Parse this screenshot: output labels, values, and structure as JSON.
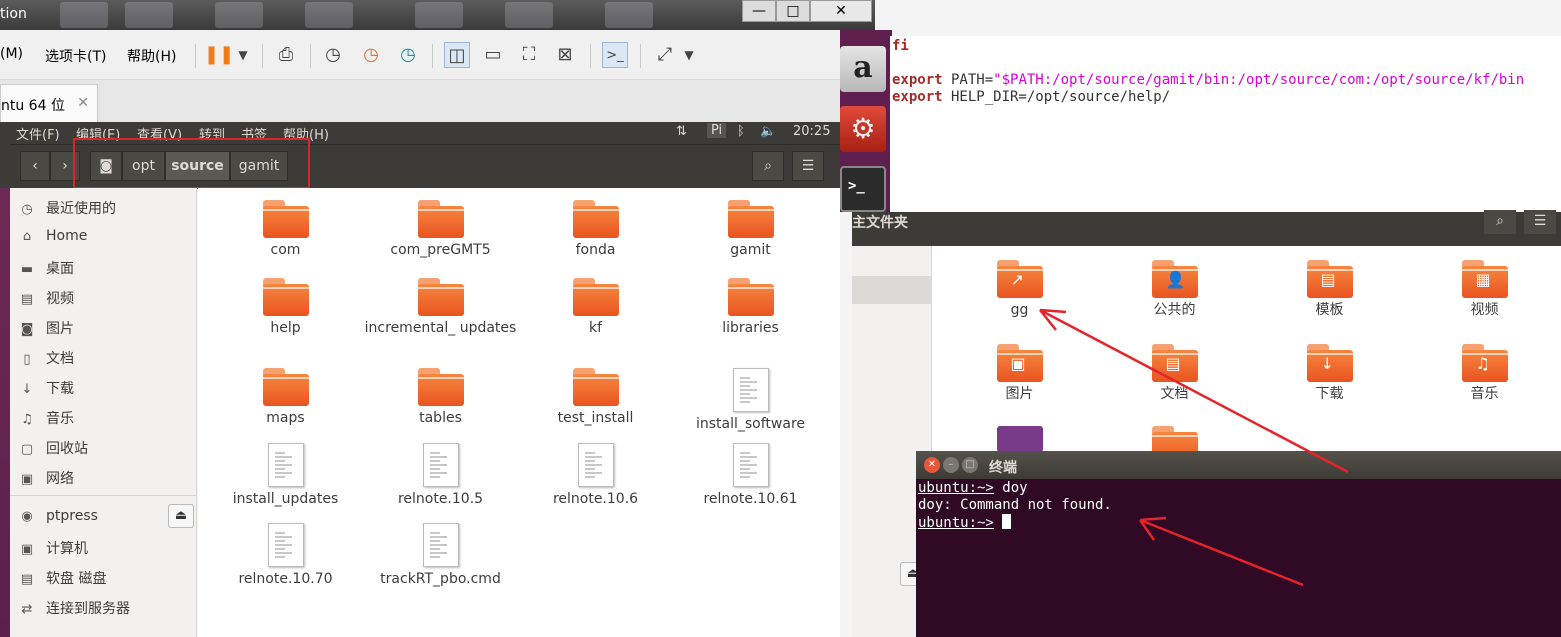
{
  "host": {
    "title_fragment": "tion",
    "menu": [
      "(M)",
      "选项卡(T)",
      "帮助(H)"
    ],
    "tab_label": "ntu 64 位"
  },
  "ubuntu_menu": {
    "items": [
      "文件(F)",
      "编辑(E)",
      "查看(V)",
      "转到",
      "书签",
      "帮助(H)"
    ],
    "indicator_pi": "Pi",
    "clock": "20:25"
  },
  "breadcrumb": [
    "opt",
    "source",
    "gamit"
  ],
  "sidebar": {
    "items": [
      {
        "icon": "clock-icon",
        "label": "最近使用的"
      },
      {
        "icon": "home-icon",
        "label": "Home"
      },
      {
        "icon": "desktop-icon",
        "label": "桌面"
      },
      {
        "icon": "video-icon",
        "label": "视频"
      },
      {
        "icon": "camera-icon",
        "label": "图片"
      },
      {
        "icon": "document-icon",
        "label": "文档"
      },
      {
        "icon": "download-icon",
        "label": "下载"
      },
      {
        "icon": "music-icon",
        "label": "音乐"
      },
      {
        "icon": "trash-icon",
        "label": "回收站"
      },
      {
        "icon": "network-icon",
        "label": "网络"
      },
      {
        "icon": "disk-icon",
        "label": "ptpress"
      },
      {
        "icon": "computer-icon",
        "label": "计算机"
      },
      {
        "icon": "floppy-icon",
        "label": "软盘 磁盘"
      },
      {
        "icon": "server-icon",
        "label": "连接到服务器"
      }
    ]
  },
  "files": [
    {
      "name": "com",
      "type": "folder"
    },
    {
      "name": "com_preGMT5",
      "type": "folder"
    },
    {
      "name": "fonda",
      "type": "folder"
    },
    {
      "name": "gamit",
      "type": "folder"
    },
    {
      "name": "help",
      "type": "folder"
    },
    {
      "name": "incremental_ updates",
      "type": "folder"
    },
    {
      "name": "kf",
      "type": "folder"
    },
    {
      "name": "libraries",
      "type": "folder"
    },
    {
      "name": "maps",
      "type": "folder"
    },
    {
      "name": "tables",
      "type": "folder"
    },
    {
      "name": "test_install",
      "type": "folder"
    },
    {
      "name": "install_software",
      "type": "doc"
    },
    {
      "name": "install_updates",
      "type": "doc"
    },
    {
      "name": "relnote.10.5",
      "type": "doc"
    },
    {
      "name": "relnote.10.6",
      "type": "doc"
    },
    {
      "name": "relnote.10.61",
      "type": "doc"
    },
    {
      "name": "relnote.10.70",
      "type": "doc"
    },
    {
      "name": "trackRT_pbo.cmd",
      "type": "doc"
    }
  ],
  "editor": {
    "line1": "fi",
    "l2_kw": "export",
    "l2_rest": " PATH=",
    "l2_str": "\"$PATH:/opt/source/gamit/bin:/opt/source/com:/opt/source/kf/bin",
    "l3_kw": "export",
    "l3_rest": " HELP_DIR=/opt/source/help/"
  },
  "right": {
    "title": "主文件夹",
    "items": [
      "gg",
      "公共的",
      "模板",
      "视频",
      "图片",
      "文档",
      "下载",
      "音乐"
    ]
  },
  "terminal": {
    "title": "终端",
    "line1_prompt": "ubuntu:~>",
    "line1_cmd": " doy",
    "line2": "doy: Command not found.",
    "line3_prompt": "ubuntu:~>"
  }
}
